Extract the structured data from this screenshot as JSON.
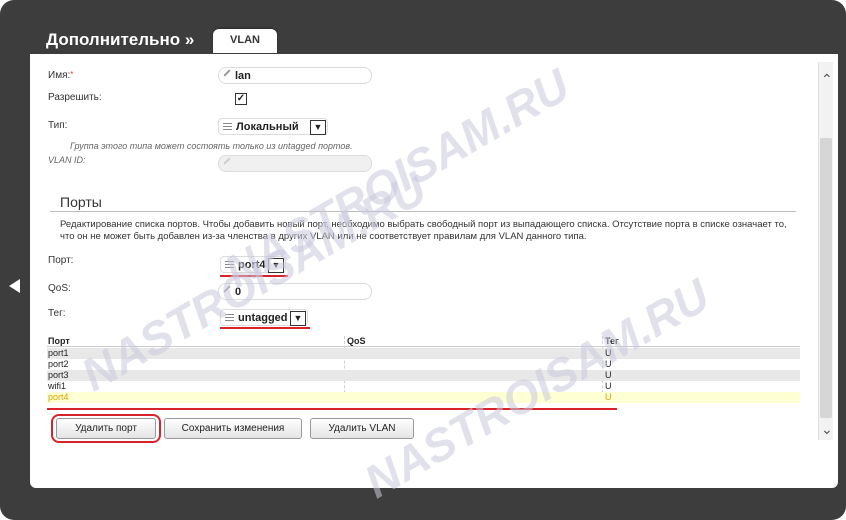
{
  "header": {
    "title": "Дополнительно »",
    "tab_label": "VLAN"
  },
  "vlan_form": {
    "name_label": "Имя:",
    "name_value": "lan",
    "enable_label": "Разрешить:",
    "enable_checked": "✓",
    "type_label": "Тип:",
    "type_value": "Локальный",
    "type_hint": "Группа этого типа может состоять только из untagged портов.",
    "vlan_id_label": "VLAN ID:"
  },
  "ports": {
    "title": "Порты",
    "description": "Редактирование списка портов. Чтобы добавить новый порт, необходимо выбрать свободный порт из выпадающего списка. Отсутствие порта в списке означает то, что он не может быть добавлен из-за членства в других VLAN или не соответствует правилам для VLAN данного типа.",
    "port_label": "Порт:",
    "port_value": "port4",
    "qos_label": "QoS:",
    "qos_value": "0",
    "tag_label": "Тег:",
    "tag_value": "untagged"
  },
  "table": {
    "columns": [
      "Порт",
      "QoS",
      "Тег"
    ],
    "rows": [
      {
        "port": "port1",
        "qos": "",
        "tag": "U"
      },
      {
        "port": "port2",
        "qos": "",
        "tag": "U"
      },
      {
        "port": "port3",
        "qos": "",
        "tag": "U"
      },
      {
        "port": "wifi1",
        "qos": "",
        "tag": "U"
      },
      {
        "port": "port4",
        "qos": "",
        "tag": "U"
      }
    ]
  },
  "buttons": {
    "delete_port": "Удалить порт",
    "save_changes": "Сохранить изменения",
    "delete_vlan": "Удалить VLAN"
  },
  "watermark": "NASTROISAM.RU",
  "colors": {
    "highlight": "#d9232a",
    "selected_row": "#ffffd4",
    "frame": "#3d3d3d"
  }
}
